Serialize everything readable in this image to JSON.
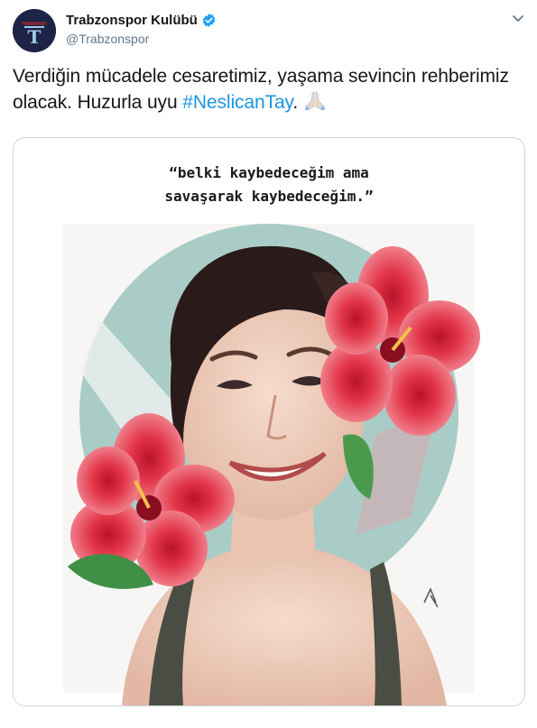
{
  "author": {
    "display_name": "Trabzonspor Kulübü",
    "handle": "@Trabzonspor",
    "verified": true,
    "avatar_icon": "trabzonspor-logo-icon"
  },
  "tweet": {
    "text_before": "Verdiğin mücadele cesaretimiz, yaşama sevincin rehberimiz olacak. Huzurla uyu ",
    "hashtag": "#NeslicanTay",
    "text_after": ".",
    "emoji": "folded-hands-icon"
  },
  "media": {
    "quote": "“belki kaybedeceğim ama\nsavaşarak kaybedeceğim.”",
    "description_icon": "portrait-illustration"
  },
  "colors": {
    "hashtag": "#1b95e0",
    "verified": "#1da1f2",
    "circle": "#a9cdc6",
    "flower": "#e8334a"
  }
}
